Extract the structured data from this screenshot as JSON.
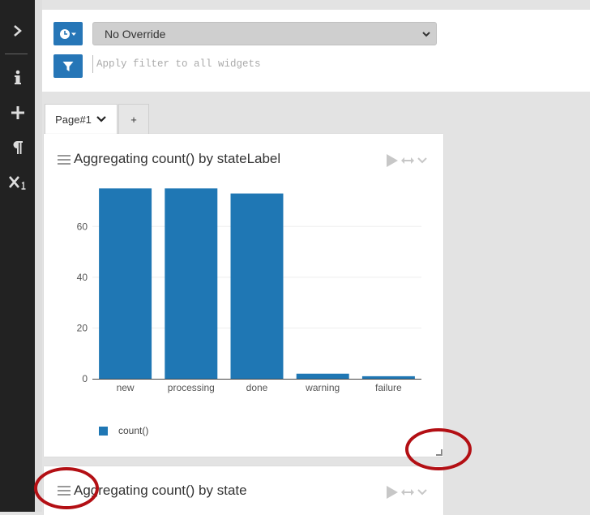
{
  "sidebar": {
    "items": [
      {
        "icon": "chevron-right-icon"
      },
      {
        "icon": "info-icon"
      },
      {
        "icon": "plus-icon"
      },
      {
        "icon": "pilcrow-icon"
      },
      {
        "icon": "subscript-x-icon"
      }
    ]
  },
  "toolbar": {
    "time_override": "No Override",
    "filter_placeholder": "Apply filter to all widgets"
  },
  "tabs": {
    "active_label": "Page#1",
    "add_label": "+"
  },
  "widgets": [
    {
      "title": "Aggregating count() by stateLabel"
    },
    {
      "title": "Aggregating count() by state"
    }
  ],
  "colors": {
    "accent": "#2676b7",
    "bar": "#1f77b4",
    "annotation": "#b30f14"
  },
  "chart_data": {
    "type": "bar",
    "categories": [
      "new",
      "processing",
      "done",
      "warning",
      "failure"
    ],
    "series": [
      {
        "name": "count()",
        "values": [
          75,
          75,
          73,
          2,
          1
        ]
      }
    ],
    "yticks": [
      0,
      20,
      40,
      60
    ],
    "ylim": [
      0,
      78
    ]
  }
}
